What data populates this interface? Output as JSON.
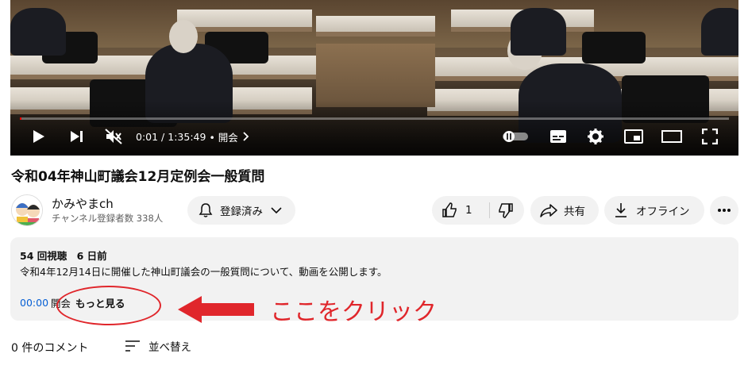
{
  "player": {
    "current_time": "0:01",
    "duration": "1:35:49",
    "separator": " / ",
    "chapter": "• 開会",
    "progress_fraction": 0.0002
  },
  "video": {
    "title": "令和04年神山町議会12月定例会一般質問"
  },
  "channel": {
    "name": "かみやまch",
    "subscribers": "チャンネル登録者数 338人"
  },
  "actions": {
    "subscribe_label": "登録済み",
    "like_count": "1",
    "share_label": "共有",
    "offline_label": "オフライン"
  },
  "description": {
    "views": "54 回視聴",
    "date": "6 日前",
    "text": "令和4年12月14日に開催した神山町議会の一般質問について、動画を公開します。",
    "chapter_time": "00:00",
    "chapter_label": "開会",
    "show_more": "もっと見る"
  },
  "annotation": {
    "text": "ここをクリック",
    "color": "#e0262b"
  },
  "comments": {
    "count_label": "0 件のコメント",
    "sort_label": "並べ替え"
  }
}
